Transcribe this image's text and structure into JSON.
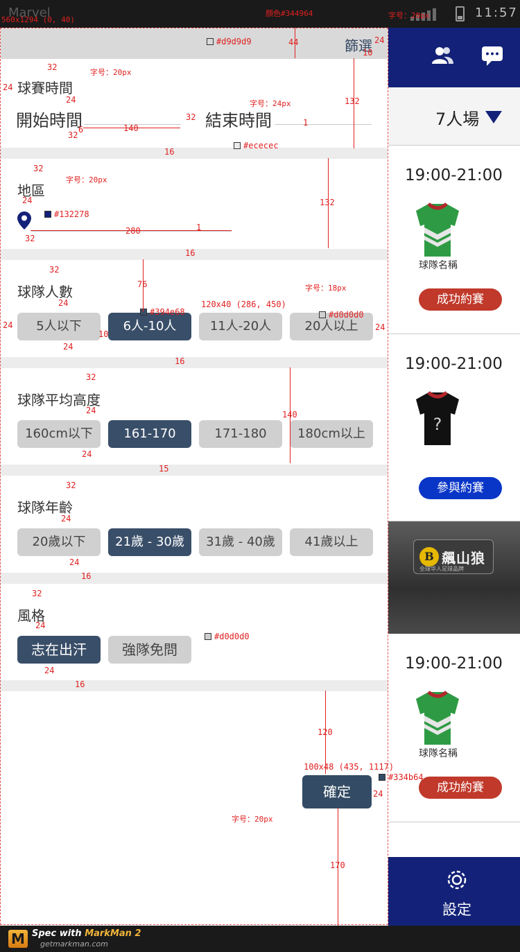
{
  "status_bar": {
    "carrier": "Marvel",
    "time": "11:57"
  },
  "spec": {
    "canvas": "560x1294 (0, 40)",
    "header_color": "顏色#344964",
    "font_20": "字号：20px",
    "font_24": "字号：24px",
    "font_18": "字号：18px",
    "sw_header": "#d9d9d9",
    "sw_divider": "#ececec",
    "sw_pin": "#132278",
    "sw_chip_on": "#394e68",
    "sw_chip_off": "#d0d0d0",
    "sw_confirm": "#334b64",
    "chip_size": "120x40 (286, 450)",
    "confirm_size": "100x48 (435, 1117)",
    "m44": "44",
    "m24": "24",
    "m10": "10",
    "m32": "32",
    "m132": "132",
    "m140": "140",
    "m16": "16",
    "m1": "1",
    "m6": "6",
    "m280": "280",
    "m76": "76",
    "m15": "15",
    "m120": "120",
    "m170": "170"
  },
  "drawer": {
    "title": "篩選",
    "match_time": {
      "title": "球賽時間",
      "start": "開始時間",
      "end": "結束時間"
    },
    "region": {
      "title": "地區"
    },
    "team_size": {
      "title": "球隊人數",
      "options": [
        "5人以下",
        "6人-10人",
        "11人-20人",
        "20人以上"
      ]
    },
    "avg_height": {
      "title": "球隊平均高度",
      "options": [
        "160cm以下",
        "161-170",
        "171-180",
        "180cm以上"
      ]
    },
    "age": {
      "title": "球隊年齡",
      "options": [
        "20歲以下",
        "21歲 - 30歲",
        "31歲 - 40歲",
        "41歲以上"
      ]
    },
    "style": {
      "title": "風格",
      "options": [
        "志在出汗",
        "強隊免問"
      ]
    },
    "confirm": "確定"
  },
  "background_app": {
    "selector": "7人場",
    "cards": [
      {
        "time": "19:00-21:00",
        "team": "球隊名稱",
        "action": "成功約賽"
      },
      {
        "time": "19:00-21:00",
        "team": "?",
        "action": "參與約賽"
      },
      {
        "time": "19:00-21:00",
        "team": "球隊名稱",
        "action": "成功約賽"
      }
    ],
    "banner": {
      "brand": "飆山狼",
      "slogan": "全球华人足球品牌"
    },
    "footer_label": "設定"
  },
  "colors": {
    "header_bg": "#d9d9d9",
    "header_text": "#344964",
    "divider": "#ececec",
    "pin": "#132278",
    "chip_on": "#394e68",
    "chip_off": "#d0d0d0",
    "confirm": "#334b64",
    "brand_blue": "#132278"
  },
  "markman": {
    "brand_prefix": "Spec with ",
    "brand": "MarkMan 2",
    "url": "getmarkman.com"
  }
}
